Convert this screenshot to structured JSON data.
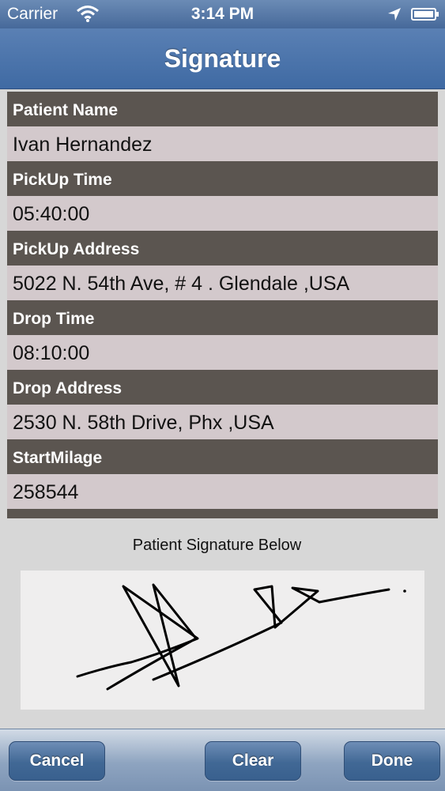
{
  "status_bar": {
    "carrier": "Carrier",
    "time": "3:14 PM"
  },
  "nav": {
    "title": "Signature"
  },
  "fields": [
    {
      "label": "Patient Name",
      "value": "Ivan Hernandez"
    },
    {
      "label": "PickUp Time",
      "value": "05:40:00"
    },
    {
      "label": "PickUp Address",
      "value": "5022 N. 54th Ave, # 4 . Glendale ,USA"
    },
    {
      "label": "Drop Time",
      "value": "08:10:00"
    },
    {
      "label": "Drop Address",
      "value": "2530 N. 58th Drive, Phx ,USA"
    },
    {
      "label": "StartMilage",
      "value": "258544"
    }
  ],
  "signature": {
    "label": "Patient Signature Below"
  },
  "toolbar": {
    "cancel_label": "Cancel",
    "clear_label": "Clear",
    "done_label": "Done"
  },
  "colors": {
    "nav_blue": "#4a70a6",
    "field_header": "#5b5550",
    "field_value": "#d3c9cc"
  }
}
